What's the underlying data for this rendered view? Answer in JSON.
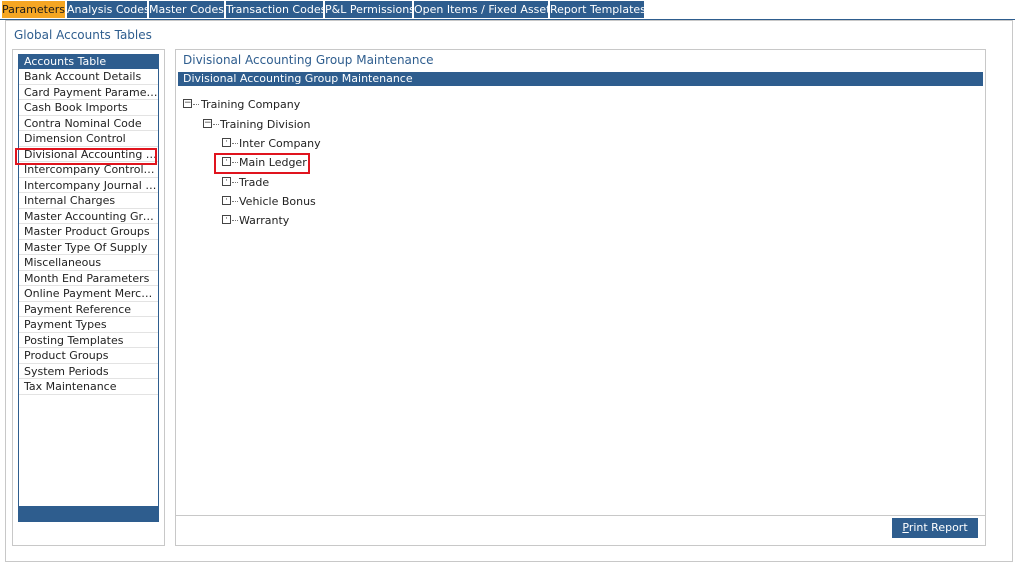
{
  "tabs": [
    {
      "label": "Parameters",
      "active": true
    },
    {
      "label": "Analysis Codes",
      "active": false
    },
    {
      "label": "Master Codes",
      "active": false
    },
    {
      "label": "Transaction Codes",
      "active": false
    },
    {
      "label": "P&L Permissions",
      "active": false
    },
    {
      "label": "Open Items / Fixed Assets",
      "active": false
    },
    {
      "label": "Report Templates",
      "active": false
    }
  ],
  "section_title": "Global Accounts Tables",
  "accounts_list": {
    "header": "Accounts Table",
    "items": [
      "Bank Account Details",
      "Card Payment Parameters",
      "Cash Book Imports",
      "Contra Nominal Code",
      "Dimension Control",
      "Divisional Accounting Gro...",
      "Intercompany Control Co...",
      "Intercompany Journal Co...",
      "Internal Charges",
      "Master Accounting Groups",
      "Master Product Groups",
      "Master Type Of Supply",
      "Miscellaneous",
      "Month End Parameters",
      "Online Payment Merchants",
      "Payment Reference",
      "Payment Types",
      "Posting Templates",
      "Product Groups",
      "System Periods",
      "Tax Maintenance"
    ],
    "selected_index": 5
  },
  "detail": {
    "title": "Divisional Accounting Group Maintenance",
    "bar_title": "Divisional Accounting Group Maintenance",
    "tree": {
      "root": {
        "label": "Training Company",
        "expander": "−"
      },
      "division": {
        "label": "Training Division",
        "expander": "−"
      },
      "children": [
        {
          "label": "Inter Company",
          "expander": "·"
        },
        {
          "label": "Main Ledger",
          "expander": "·"
        },
        {
          "label": "Trade",
          "expander": "·"
        },
        {
          "label": "Vehicle Bonus",
          "expander": "·"
        },
        {
          "label": "Warranty",
          "expander": "·"
        }
      ]
    },
    "print_button": {
      "accesskey": "P",
      "rest": "rint Report"
    }
  },
  "colors": {
    "accent": "#2e5d8e",
    "active_tab": "#f5a623",
    "highlight": "#e0141e"
  }
}
